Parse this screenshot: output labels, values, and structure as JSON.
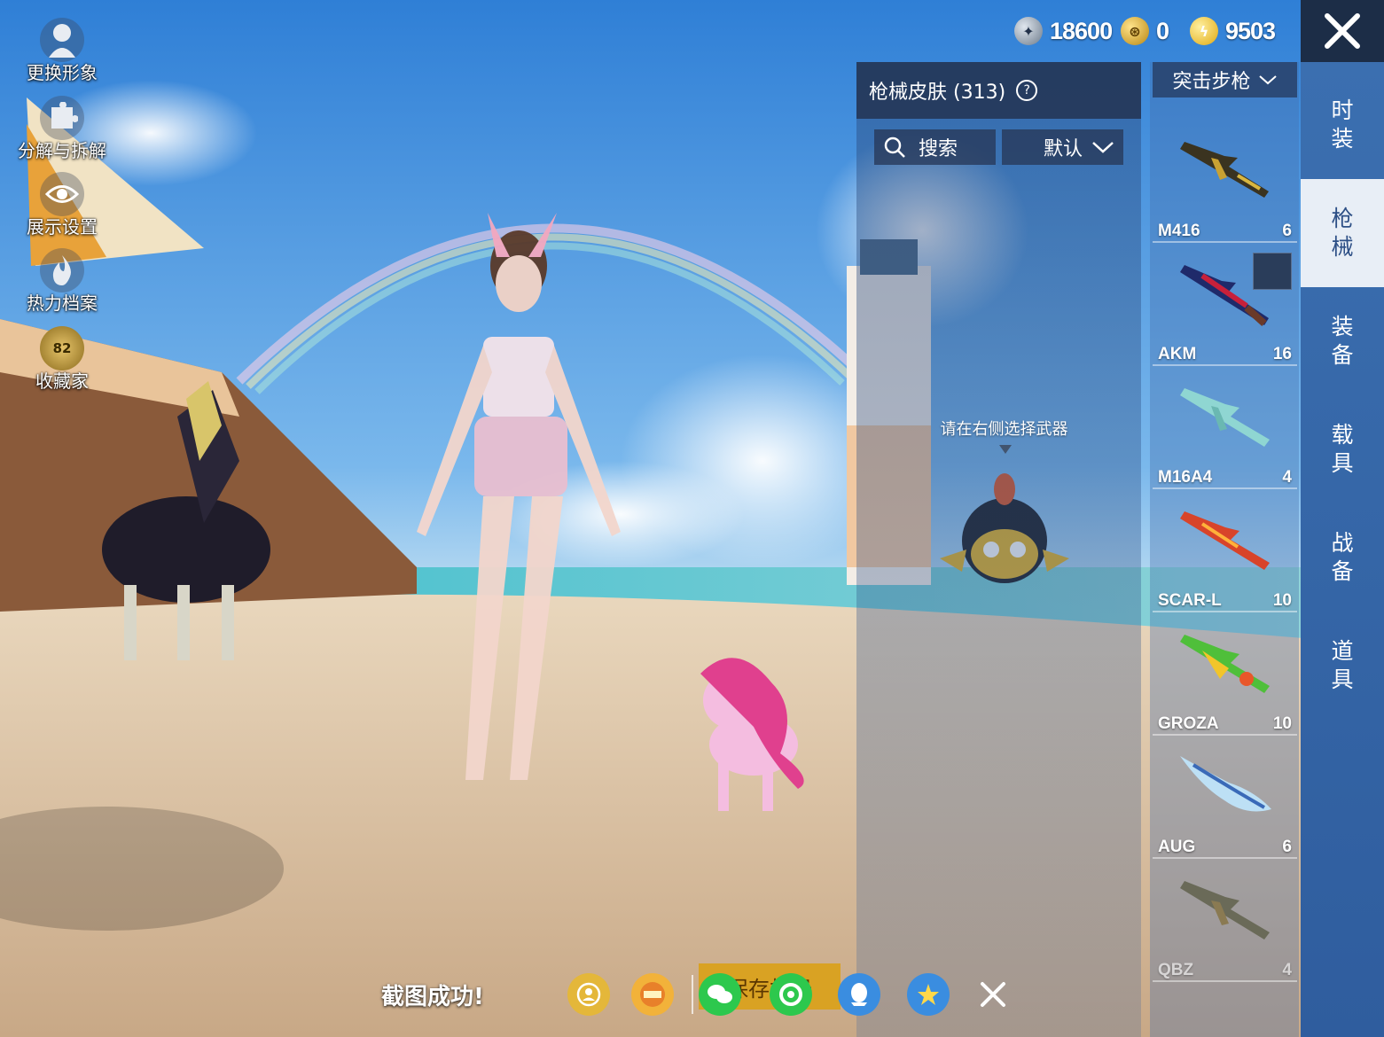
{
  "currency": {
    "silver": "18600",
    "gold": "0",
    "bolt": "9503"
  },
  "left_menu": [
    {
      "label": "更换形象",
      "icon": "avatar-icon"
    },
    {
      "label": "分解与拆解",
      "icon": "puzzle-icon"
    },
    {
      "label": "展示设置",
      "icon": "eye-icon"
    },
    {
      "label": "热力档案",
      "icon": "flame-icon"
    },
    {
      "label": "收藏家",
      "icon": "collector-badge-icon",
      "badge": "82"
    }
  ],
  "panel": {
    "title": "枪械皮肤 (313)",
    "search_label": "搜索",
    "sort_label": "默认",
    "hint": "请在右侧选择武器"
  },
  "weapon_category": "突击步枪",
  "weapons": [
    {
      "name": "M416",
      "count": "6"
    },
    {
      "name": "AKM",
      "count": "16"
    },
    {
      "name": "M16A4",
      "count": "4"
    },
    {
      "name": "SCAR-L",
      "count": "10"
    },
    {
      "name": "GROZA",
      "count": "10"
    },
    {
      "name": "AUG",
      "count": "6"
    },
    {
      "name": "QBZ",
      "count": "4"
    }
  ],
  "tabs": [
    {
      "label": "时装",
      "active": false
    },
    {
      "label": "枪械",
      "active": true
    },
    {
      "label": "装备",
      "active": false
    },
    {
      "label": "载具",
      "active": false
    },
    {
      "label": "战备",
      "active": false
    },
    {
      "label": "道具",
      "active": false
    }
  ],
  "share": {
    "label": "截图成功!",
    "save_label": "保存相册"
  },
  "colors": {
    "tab_bar": "#3b6fb0",
    "tab_active": "#e8eef6",
    "save_button": "#d9a223"
  }
}
